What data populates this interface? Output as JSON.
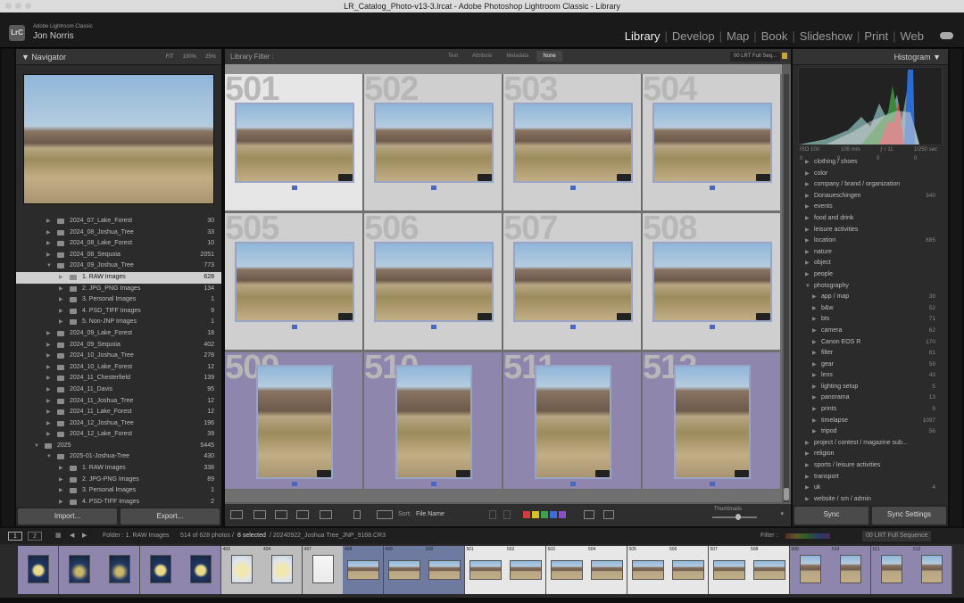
{
  "window": {
    "title": "LR_Catalog_Photo-v13-3.lrcat - Adobe Photoshop Lightroom Classic - Library"
  },
  "identity": {
    "logo": "LrC",
    "brand": "Adobe Lightroom Classic",
    "user": "Jon Norris"
  },
  "modules": [
    "Library",
    "Develop",
    "Map",
    "Book",
    "Slideshow",
    "Print",
    "Web"
  ],
  "active_module": "Library",
  "navigator": {
    "title": "Navigator",
    "zoom": [
      "FIT",
      "100%",
      "25%"
    ]
  },
  "folders": [
    {
      "name": "2024_07_Lake_Forest",
      "count": "30",
      "level": 2
    },
    {
      "name": "2024_08_Joshua_Tree",
      "count": "33",
      "level": 2
    },
    {
      "name": "2024_08_Lake_Forest",
      "count": "10",
      "level": 2
    },
    {
      "name": "2024_08_Sequoia",
      "count": "2051",
      "level": 2
    },
    {
      "name": "2024_09_Joshua_Tree",
      "count": "773",
      "level": 2,
      "open": true
    },
    {
      "name": "1. RAW Images",
      "count": "628",
      "level": 3,
      "selected": true
    },
    {
      "name": "2. JPG_PNG Images",
      "count": "134",
      "level": 3
    },
    {
      "name": "3. Personal Images",
      "count": "1",
      "level": 3
    },
    {
      "name": "4. PSD_TIFF Images",
      "count": "9",
      "level": 3
    },
    {
      "name": "5. Non-JNP Images",
      "count": "1",
      "level": 3
    },
    {
      "name": "2024_09_Lake_Forest",
      "count": "18",
      "level": 2
    },
    {
      "name": "2024_09_Sequoia",
      "count": "402",
      "level": 2
    },
    {
      "name": "2024_10_Joshua_Tree",
      "count": "278",
      "level": 2
    },
    {
      "name": "2024_10_Lake_Forest",
      "count": "12",
      "level": 2
    },
    {
      "name": "2024_11_Chesterfield",
      "count": "139",
      "level": 2
    },
    {
      "name": "2024_11_Davis",
      "count": "95",
      "level": 2
    },
    {
      "name": "2024_11_Joshua_Tree",
      "count": "12",
      "level": 2
    },
    {
      "name": "2024_11_Lake_Forest",
      "count": "12",
      "level": 2
    },
    {
      "name": "2024_12_Joshua_Tree",
      "count": "196",
      "level": 2
    },
    {
      "name": "2024_12_Lake_Forest",
      "count": "39",
      "level": 2
    },
    {
      "name": "2025",
      "count": "5445",
      "level": 1,
      "open": true
    },
    {
      "name": "2025-01-Joshua-Tree",
      "count": "430",
      "level": 2,
      "open": true
    },
    {
      "name": "1. RAW Images",
      "count": "338",
      "level": 3
    },
    {
      "name": "2. JPG-PNG Images",
      "count": "89",
      "level": 3
    },
    {
      "name": "3. Personal Images",
      "count": "1",
      "level": 3
    },
    {
      "name": "4. PSD-TIFF Images",
      "count": "2",
      "level": 3
    }
  ],
  "left_buttons": {
    "import": "Import...",
    "export": "Export..."
  },
  "filter": {
    "label": "Library Filter :",
    "tabs": [
      "Text",
      "Attribute",
      "Metadata",
      "None"
    ],
    "active": "None",
    "preset": "00 LRT Full Seq..."
  },
  "grid": [
    {
      "num": "501",
      "orient": "land",
      "bg": "#e6e6e6"
    },
    {
      "num": "502",
      "orient": "land",
      "bg": "#cfcfcf"
    },
    {
      "num": "503",
      "orient": "land",
      "bg": "#cfcfcf"
    },
    {
      "num": "504",
      "orient": "land",
      "bg": "#cfcfcf"
    },
    {
      "num": "505",
      "orient": "land",
      "bg": "#cfcfcf"
    },
    {
      "num": "506",
      "orient": "land",
      "bg": "#cfcfcf"
    },
    {
      "num": "507",
      "orient": "land",
      "bg": "#cfcfcf"
    },
    {
      "num": "508",
      "orient": "land",
      "bg": "#cfcfcf"
    },
    {
      "num": "509",
      "orient": "port",
      "bg": "#8e86ad"
    },
    {
      "num": "510",
      "orient": "port",
      "bg": "#8e86ad"
    },
    {
      "num": "511",
      "orient": "port",
      "bg": "#8e86ad"
    },
    {
      "num": "512",
      "orient": "port",
      "bg": "#8e86ad"
    }
  ],
  "toolbar": {
    "sort_label": "Sort:",
    "sort_value": "File Name",
    "thumbnails_label": "Thumbnails",
    "colors": [
      "#d23c3c",
      "#d6c21f",
      "#3fa24a",
      "#3c6fd6",
      "#8a4fc1"
    ]
  },
  "histogram": {
    "title": "Histogram",
    "iso": "ISO 100",
    "focal": "105 mm",
    "aperture": "ƒ / 11",
    "shutter": "1/250 sec",
    "counts": [
      "0",
      "0",
      "0",
      "0"
    ]
  },
  "keywords": [
    {
      "name": "clothing / shoes",
      "count": "",
      "indent": 0
    },
    {
      "name": "color",
      "count": "",
      "indent": 0
    },
    {
      "name": "company / brand / organization",
      "count": "",
      "indent": 0
    },
    {
      "name": "Donaueschingen",
      "count": "340",
      "indent": 0
    },
    {
      "name": "events",
      "count": "",
      "indent": 0
    },
    {
      "name": "food and drink",
      "count": "",
      "indent": 0
    },
    {
      "name": "leisure activities",
      "count": "",
      "indent": 0
    },
    {
      "name": "location",
      "count": "885",
      "indent": 0
    },
    {
      "name": "nature",
      "count": "",
      "indent": 0
    },
    {
      "name": "object",
      "count": "",
      "indent": 0
    },
    {
      "name": "people",
      "count": "",
      "indent": 0
    },
    {
      "name": "photography",
      "count": "",
      "indent": 0,
      "open": true
    },
    {
      "name": "app / map",
      "count": "39",
      "indent": 1
    },
    {
      "name": "b&w",
      "count": "52",
      "indent": 1
    },
    {
      "name": "bts",
      "count": "71",
      "indent": 1
    },
    {
      "name": "camera",
      "count": "62",
      "indent": 1
    },
    {
      "name": "Canon EOS R",
      "count": "170",
      "indent": 1
    },
    {
      "name": "filter",
      "count": "81",
      "indent": 1
    },
    {
      "name": "gear",
      "count": "59",
      "indent": 1
    },
    {
      "name": "lens",
      "count": "43",
      "indent": 1
    },
    {
      "name": "lighting setup",
      "count": "5",
      "indent": 1
    },
    {
      "name": "panorama",
      "count": "13",
      "indent": 1
    },
    {
      "name": "prints",
      "count": "9",
      "indent": 1
    },
    {
      "name": "timelapse",
      "count": "1097",
      "indent": 1
    },
    {
      "name": "tripod",
      "count": "56",
      "indent": 1
    },
    {
      "name": "project / contest / magazine sub...",
      "count": "",
      "indent": 0
    },
    {
      "name": "religion",
      "count": "",
      "indent": 0
    },
    {
      "name": "sports / leisure activities",
      "count": "",
      "indent": 0
    },
    {
      "name": "transport",
      "count": "",
      "indent": 0
    },
    {
      "name": "uk",
      "count": "4",
      "indent": 0
    },
    {
      "name": "website / sm / admin",
      "count": "",
      "indent": 0
    }
  ],
  "right_buttons": {
    "sync": "Sync",
    "sync_settings": "Sync Settings"
  },
  "status": {
    "page1": "1",
    "page2": "2",
    "folder": "Folder : 1. RAW Images",
    "count": "514 of 628 photos /",
    "selected": "8 selected",
    "file": "/ 20240922_Joshua Tree_JNP_9168.CR3",
    "filter_label": "Filter :",
    "filter_preset": "00 LRT Full Sequence"
  },
  "filmstrip": [
    {
      "n": "",
      "kind": "tree",
      "bg": "#8e86ad"
    },
    {
      "n": "",
      "kind": "dark",
      "bg": "#8e86ad"
    },
    {
      "n": "",
      "kind": "dark",
      "bg": "#8e86ad"
    },
    {
      "n": "",
      "kind": "tree",
      "bg": "#8e86ad"
    },
    {
      "n": "",
      "kind": "tree",
      "bg": "#8e86ad"
    },
    {
      "n": "493",
      "kind": "bright",
      "bg": "#bdbdbd"
    },
    {
      "n": "494",
      "kind": "bright",
      "bg": "#bdbdbd"
    },
    {
      "n": "497",
      "kind": "white",
      "bg": "#bdbdbd"
    },
    {
      "n": "498",
      "kind": "desert",
      "bg": "#6f7aa0"
    },
    {
      "n": "499",
      "kind": "desert",
      "bg": "#6f7aa0"
    },
    {
      "n": "500",
      "kind": "desert",
      "bg": "#6f7aa0"
    },
    {
      "n": "501",
      "kind": "desert",
      "bg": "#e7e7e7"
    },
    {
      "n": "502",
      "kind": "desert",
      "bg": "#e7e7e7"
    },
    {
      "n": "503",
      "kind": "desert",
      "bg": "#e7e7e7"
    },
    {
      "n": "504",
      "kind": "desert",
      "bg": "#e7e7e7"
    },
    {
      "n": "505",
      "kind": "desert",
      "bg": "#e7e7e7"
    },
    {
      "n": "506",
      "kind": "desert",
      "bg": "#e7e7e7"
    },
    {
      "n": "507",
      "kind": "desert",
      "bg": "#e7e7e7"
    },
    {
      "n": "508",
      "kind": "desert",
      "bg": "#e7e7e7"
    },
    {
      "n": "509",
      "kind": "desert",
      "bg": "#8e86ad"
    },
    {
      "n": "510",
      "kind": "desert",
      "bg": "#8e86ad"
    },
    {
      "n": "511",
      "kind": "desert",
      "bg": "#8e86ad"
    },
    {
      "n": "512",
      "kind": "desert",
      "bg": "#8e86ad"
    }
  ]
}
